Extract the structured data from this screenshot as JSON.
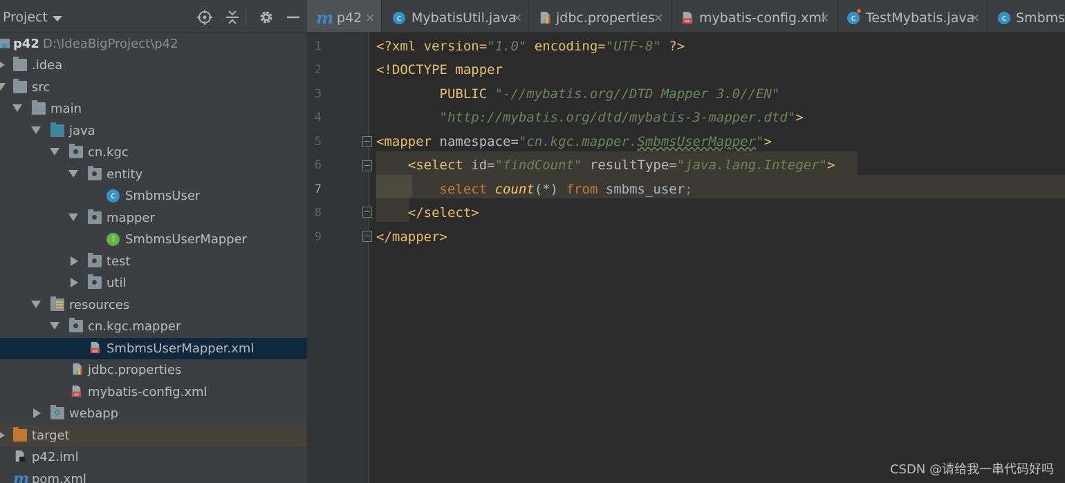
{
  "project_panel": {
    "title": "Project",
    "tree": [
      {
        "label": "p42",
        "path": "D:\\IdeaBigProject\\p42",
        "icon": "module-icon",
        "arrow": "down",
        "level": 0
      },
      {
        "label": ".idea",
        "icon": "folder-icon",
        "arrow": "right",
        "level": 0
      },
      {
        "label": "src",
        "icon": "folder-icon",
        "arrow": "down",
        "level": 0
      },
      {
        "label": "main",
        "icon": "folder-icon",
        "arrow": "down",
        "level": 1
      },
      {
        "label": "java",
        "icon": "source-folder-icon",
        "arrow": "down",
        "level": 2
      },
      {
        "label": "cn.kgc",
        "icon": "package-icon",
        "arrow": "down",
        "level": 3
      },
      {
        "label": "entity",
        "icon": "package-icon",
        "arrow": "down",
        "level": 4
      },
      {
        "label": "SmbmsUser",
        "icon": "class-icon",
        "arrow": "none",
        "level": 5
      },
      {
        "label": "mapper",
        "icon": "package-icon",
        "arrow": "down",
        "level": 4
      },
      {
        "label": "SmbmsUserMapper",
        "icon": "interface-icon",
        "arrow": "none",
        "level": 5
      },
      {
        "label": "test",
        "icon": "package-icon",
        "arrow": "right",
        "level": 4
      },
      {
        "label": "util",
        "icon": "package-icon",
        "arrow": "right",
        "level": 4
      },
      {
        "label": "resources",
        "icon": "resources-folder-icon",
        "arrow": "down",
        "level": 2
      },
      {
        "label": "cn.kgc.mapper",
        "icon": "package-icon",
        "arrow": "down",
        "level": 3
      },
      {
        "label": "SmbmsUserMapper.xml",
        "icon": "xml-file-icon",
        "arrow": "none",
        "level": 4,
        "selected": true
      },
      {
        "label": "jdbc.properties",
        "icon": "properties-file-icon",
        "arrow": "none",
        "level": 3
      },
      {
        "label": "mybatis-config.xml",
        "icon": "xml-file-icon",
        "arrow": "none",
        "level": 3
      },
      {
        "label": "webapp",
        "icon": "web-folder-icon",
        "arrow": "right",
        "level": 2
      },
      {
        "label": "target",
        "icon": "excluded-folder-icon",
        "arrow": "right",
        "level": 0,
        "excluded": true
      },
      {
        "label": "p42.iml",
        "icon": "iml-file-icon",
        "arrow": "none",
        "level": 0
      },
      {
        "label": "pom.xml",
        "icon": "maven-icon",
        "arrow": "none",
        "level": 0
      }
    ]
  },
  "tabs": [
    {
      "label": "p42",
      "icon": "maven-icon"
    },
    {
      "label": "MybatisUtil.java",
      "icon": "class-icon"
    },
    {
      "label": "jdbc.properties",
      "icon": "properties-file-icon"
    },
    {
      "label": "mybatis-config.xml",
      "icon": "xml-file-icon"
    },
    {
      "label": "TestMybatis.java",
      "icon": "test-class-icon"
    },
    {
      "label": "SmbmsU",
      "icon": "class-icon"
    }
  ],
  "tab_close": "×",
  "editor": {
    "line_numbers": [
      "1",
      "2",
      "3",
      "4",
      "5",
      "6",
      "7",
      "8",
      "9"
    ],
    "code": {
      "l1a": "<?xml version=",
      "l1b": "\"1.0\"",
      "l1c": " encoding=",
      "l1d": "\"UTF-8\"",
      "l1e": " ?>",
      "l2": "<!DOCTYPE mapper",
      "l3a": "        PUBLIC ",
      "l3b": "\"-//mybatis.org//DTD Mapper 3.0//EN\"",
      "l4": "        \"http://mybatis.org/dtd/mybatis-3-mapper.dtd\"",
      "l4b": ">",
      "l5a": "<mapper ",
      "l5b": "namespace=",
      "l5c": "\"cn.kgc.mapper.",
      "l5d": "SmbmsUserMapper",
      "l5e": "\"",
      "l5f": ">",
      "l6a": "    <select ",
      "l6b": "id=",
      "l6c": "\"findCount\"",
      "l6d": " resultType=",
      "l6e": "\"java.lang.Integer\"",
      "l6f": ">",
      "l7a": "        ",
      "l7b": "select ",
      "l7c": "count",
      "l7d": "(*) ",
      "l7e": "from ",
      "l7f": "smbms_user",
      "l7g": ";",
      "l8": "    </select>",
      "l9": "</mapper>"
    }
  },
  "watermark": "CSDN @请给我一串代码好吗"
}
